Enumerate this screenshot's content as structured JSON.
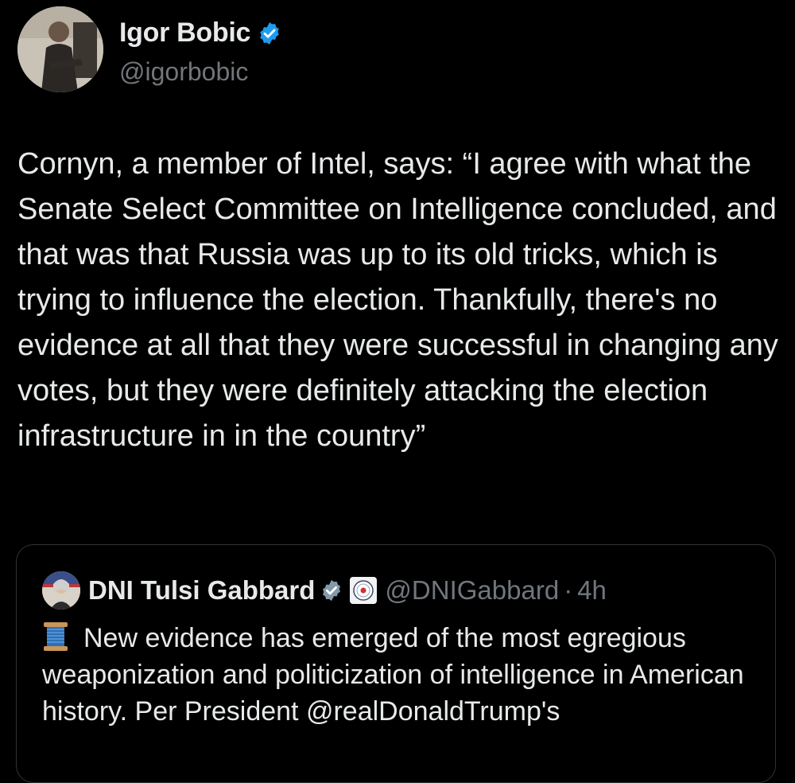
{
  "author": {
    "name": "Igor Bobic",
    "handle": "@igorbobic",
    "verified_icon": "verified-badge-icon",
    "badge_color": "#1d9bf0"
  },
  "tweet": {
    "text": "Cornyn, a member of Intel, says: “I agree with what the Senate Select Committee on Intelligence concluded, and that was that Russia was up to its old tricks, which is trying to influence the election. Thankfully, there's no evidence at all that they were successful in changing any votes, but they were definitely attacking the election infrastructure in in the country”"
  },
  "quoted": {
    "name": "DNI Tulsi Gabbard",
    "verified_icon": "verified-badge-gray-icon",
    "affiliation_icon": "dni-seal-icon",
    "handle": "@DNIGabbard",
    "separator": "·",
    "time": "4h",
    "emoji_icon": "thread-spool-icon",
    "text": "New evidence has emerged of the most egregious weaponization and politicization of intelligence in American history. Per President @realDonaldTrump's"
  }
}
